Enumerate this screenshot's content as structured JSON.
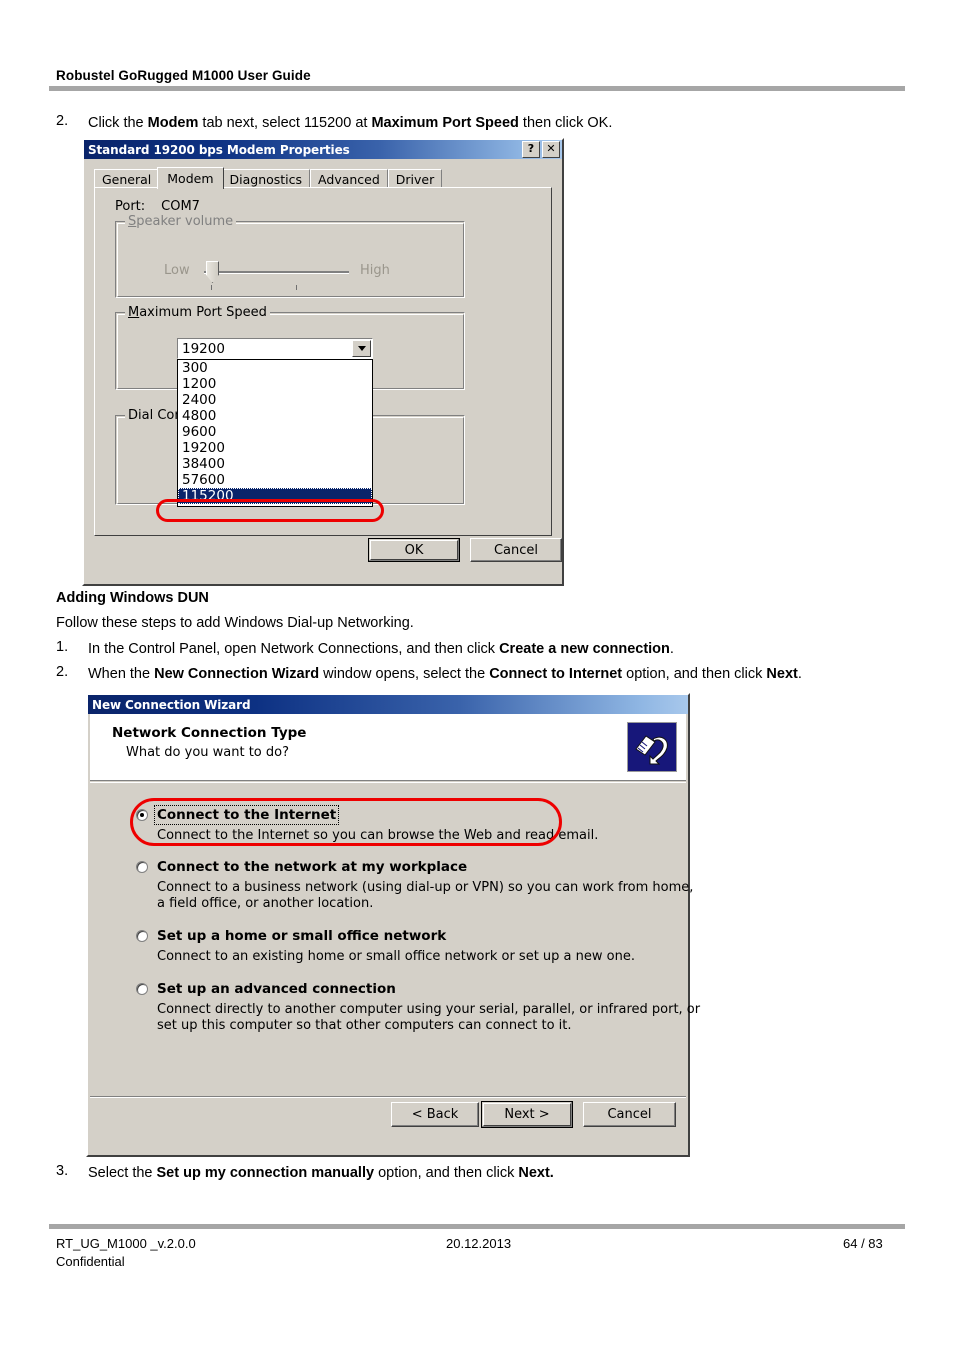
{
  "document": {
    "header": "Robustel GoRugged M1000 User Guide",
    "footer": {
      "left": "RT_UG_M1000 _v.2.0.0",
      "left2": "Confidential",
      "center": "20.12.2013",
      "right": "64 / 83"
    }
  },
  "steps": {
    "step2_modem": {
      "number": "2.",
      "part1": "Click the ",
      "bold1": "Modem",
      "part2": " tab next, select 115200 at ",
      "bold2": "Maximum Port Speed",
      "part3": " then click OK."
    },
    "section_heading": "Adding Windows DUN",
    "section_intro": "Follow these steps to add Windows Dial-up Networking.",
    "step1_dun": {
      "number": "1.",
      "part1": "In the Control Panel, open Network Connections, and then click ",
      "bold1": "Create a new connection",
      "part2": "."
    },
    "step2_dun": {
      "number": "2.",
      "part1": "When the ",
      "bold1": "New Connection Wizard",
      "part2": " window opens, select the ",
      "bold2": "Connect to Internet",
      "part3": " option, and then click ",
      "bold3": "Next",
      "part4": "."
    },
    "step3_dun": {
      "number": "3.",
      "part1": "Select the ",
      "bold1": "Set up my connection manually",
      "part2": " option, and then click ",
      "bold2": "Next."
    }
  },
  "modem_dialog": {
    "title": "Standard 19200 bps Modem Properties",
    "help_button": "?",
    "close_button": "✕",
    "tabs": [
      {
        "label": "General",
        "active": false
      },
      {
        "label": "Modem",
        "active": true
      },
      {
        "label": "Diagnostics",
        "active": false
      },
      {
        "label": "Advanced",
        "active": false
      },
      {
        "label": "Driver",
        "active": false
      }
    ],
    "port_label": "Port:",
    "port_value": "COM7",
    "speaker_volume": {
      "group_label_u": "S",
      "group_label_rest": "peaker volume",
      "low": "Low",
      "high": "High"
    },
    "max_port_speed": {
      "group_label_u": "M",
      "group_label_rest": "aximum Port Speed",
      "selected_value": "19200",
      "options": [
        "300",
        "1200",
        "2400",
        "4800",
        "9600",
        "19200",
        "38400",
        "57600",
        "115200"
      ],
      "highlighted_option": "115200"
    },
    "dial_control": {
      "group_label": "Dial Cont"
    },
    "ok_button": "OK",
    "cancel_button": "Cancel"
  },
  "wizard_dialog": {
    "title": "New Connection Wizard",
    "page_title": "Network Connection Type",
    "page_subtitle": "What do you want to do?",
    "icon_name": "network-plug-icon",
    "options": [
      {
        "title": "Connect to the Internet",
        "desc1": "Connect to the Internet so you can browse the Web and read email.",
        "desc2": "",
        "selected": true,
        "highlighted": true
      },
      {
        "title": "Connect to the network at my workplace",
        "desc1": "Connect to a business network (using dial-up or VPN) so you can work from home,",
        "desc2": "a field office, or another location.",
        "selected": false,
        "highlighted": false
      },
      {
        "title": "Set up a home or small office network",
        "desc1": "Connect to an existing home or small office network or set up a new one.",
        "desc2": "",
        "selected": false,
        "highlighted": false
      },
      {
        "title": "Set up an advanced connection",
        "desc1": "Connect directly to another computer using your serial, parallel, or infrared port, or",
        "desc2": "set up this computer so that other computers can connect to it.",
        "selected": false,
        "highlighted": false
      }
    ],
    "back_button": "< Back",
    "next_button": "Next >",
    "cancel_button": "Cancel"
  },
  "colors": {
    "annotation_red": "#ee0000",
    "selection_navy": "#0a246a",
    "window_face": "#d4d0c8",
    "rule_gray": "#a6a6a6"
  }
}
